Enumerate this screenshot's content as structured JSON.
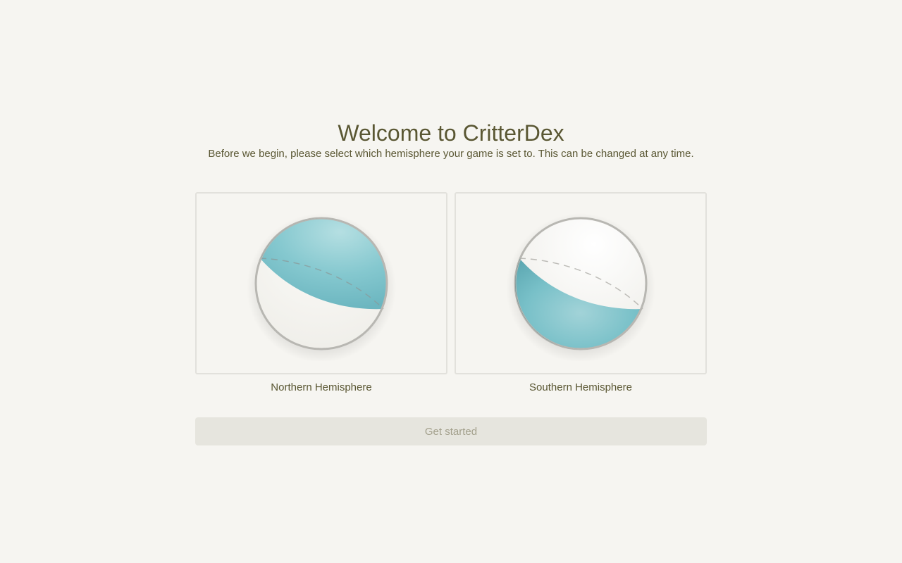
{
  "welcome": {
    "title": "Welcome to CritterDex",
    "subtitle": "Before we begin, please select which hemisphere your game is set to. This can be changed at any time."
  },
  "hemispheres": [
    {
      "label": "Northern Hemisphere",
      "icon": "northern-hemisphere-globe-icon"
    },
    {
      "label": "Southern Hemisphere",
      "icon": "southern-hemisphere-globe-icon"
    }
  ],
  "actions": {
    "get_started_label": "Get started",
    "get_started_enabled": false
  },
  "colors": {
    "background": "#f6f5f1",
    "text": "#5a5733",
    "accent_teal": "#7ec3cc",
    "button_disabled_bg": "#e6e5de",
    "button_disabled_text": "#a3a08c"
  }
}
